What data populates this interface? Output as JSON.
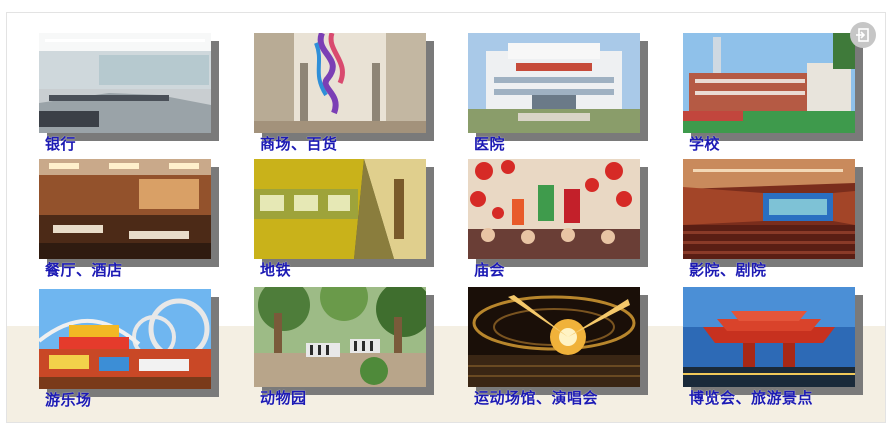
{
  "places": [
    {
      "label": "银行"
    },
    {
      "label": "商场、百货"
    },
    {
      "label": "医院"
    },
    {
      "label": "学校"
    },
    {
      "label": "餐厅、酒店"
    },
    {
      "label": "地铁"
    },
    {
      "label": "庙会"
    },
    {
      "label": "影院、剧院"
    },
    {
      "label": "游乐场"
    },
    {
      "label": "动物园"
    },
    {
      "label": "运动场馆、演唱会"
    },
    {
      "label": "博览会、旅游景点"
    }
  ],
  "corner_button": {
    "icon": "exit-icon"
  }
}
